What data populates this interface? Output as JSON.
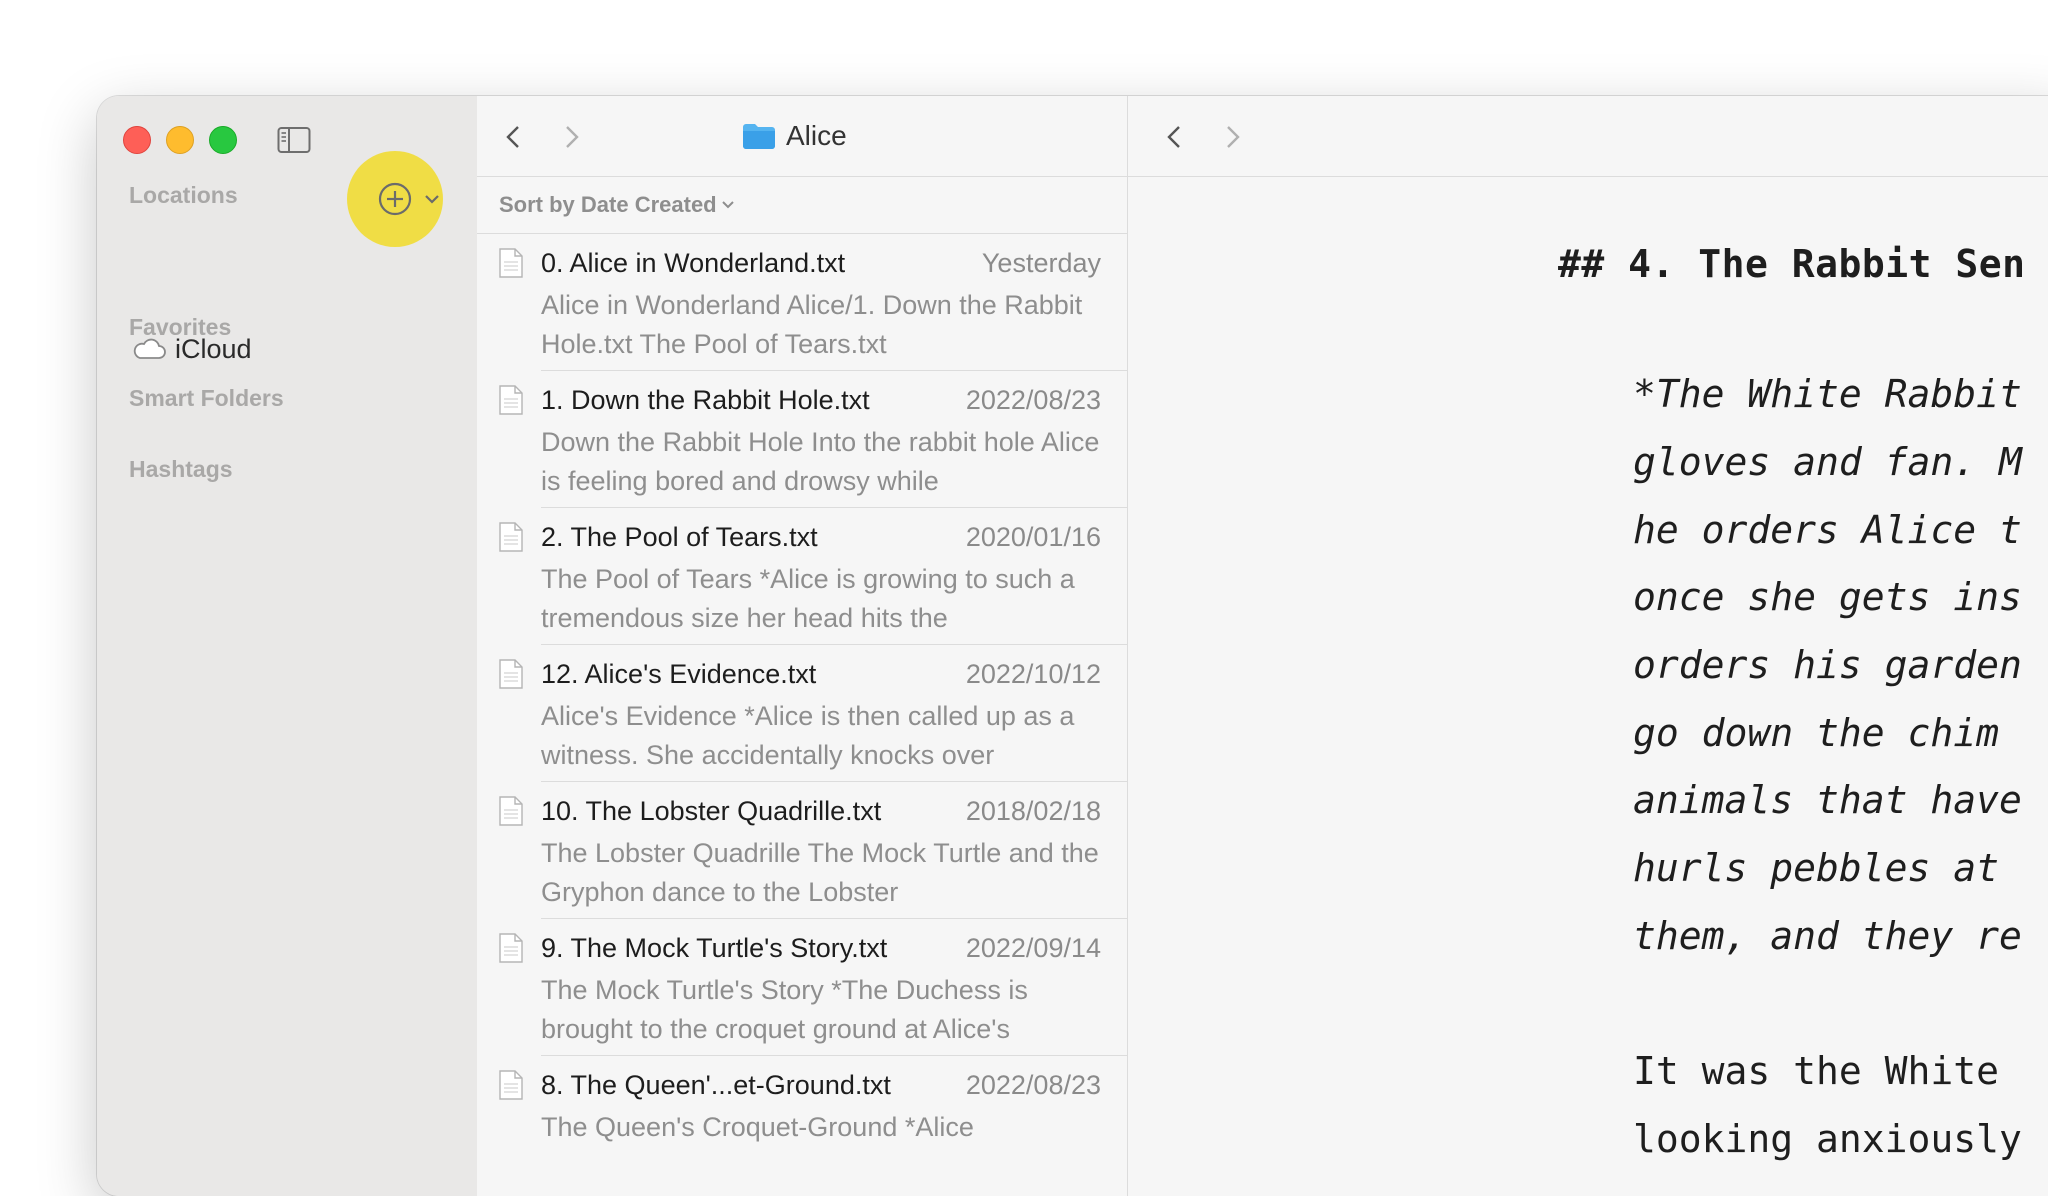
{
  "sidebar": {
    "sections": {
      "locations": "Locations",
      "favorites": "Favorites",
      "smart_folders": "Smart Folders",
      "hashtags": "Hashtags"
    },
    "icloud_label": "iCloud",
    "add_button_icon": "plus-circle-icon",
    "highlight_color": "#f0dc3c"
  },
  "list": {
    "folder_name": "Alice",
    "sort_label": "Sort by Date Created",
    "files": [
      {
        "name": "0. Alice in Wonderland.txt",
        "date": "Yesterday",
        "preview": "Alice in Wonderland Alice/1. Down the Rabbit Hole.txt The Pool of Tears.txt"
      },
      {
        "name": "1. Down the Rabbit Hole.txt",
        "date": "2022/08/23",
        "preview": "Down the Rabbit Hole Into the rabbit hole Alice is feeling bored and drowsy while"
      },
      {
        "name": "2. The Pool of Tears.txt",
        "date": "2020/01/16",
        "preview": "The Pool of Tears *Alice is growing to such a tremendous size her head hits the"
      },
      {
        "name": "12. Alice's Evidence.txt",
        "date": "2022/10/12",
        "preview": "Alice's Evidence *Alice is then called up as a witness. She accidentally knocks over"
      },
      {
        "name": "10. The Lobster Quadrille.txt",
        "date": "2018/02/18",
        "preview": "The Lobster Quadrille The Mock Turtle and the Gryphon dance to the Lobster"
      },
      {
        "name": "9. The Mock Turtle's Story.txt",
        "date": "2022/09/14",
        "preview": "The Mock Turtle's Story *The Duchess is brought to the croquet ground at Alice's"
      },
      {
        "name": "8. The Queen'...et-Ground.txt",
        "date": "2022/08/23",
        "preview": "The Queen's Croquet-Ground *Alice"
      }
    ]
  },
  "editor": {
    "heading": "## 4. The Rabbit Sen",
    "italic_lines": [
      "*The White Rabbit",
      "gloves and fan. M",
      "he orders Alice t",
      "once she gets ins",
      "orders his garden",
      "go down the chim",
      "animals that have",
      "hurls pebbles at",
      "them, and they re"
    ],
    "body_lines": [
      "It was the White",
      "looking anxiously"
    ]
  }
}
